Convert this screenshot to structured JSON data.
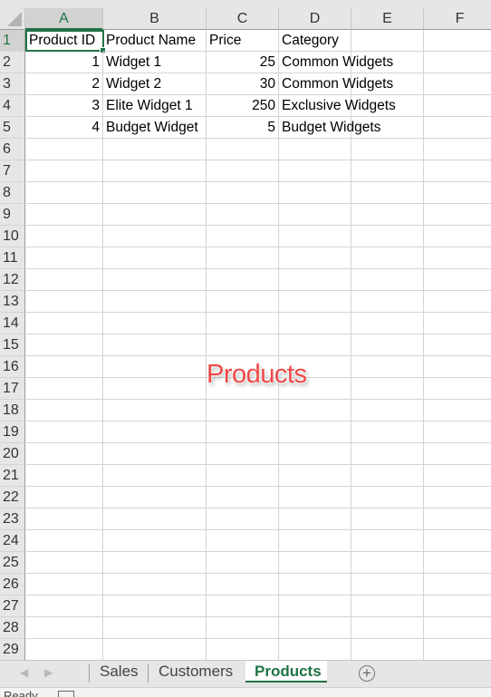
{
  "spreadsheet": {
    "columns": [
      "A",
      "B",
      "C",
      "D",
      "E",
      "F"
    ],
    "selected_column": "A",
    "selected_row": "1",
    "active_cell": "A1",
    "rows": [
      "1",
      "2",
      "3",
      "4",
      "5",
      "6",
      "7",
      "8",
      "9",
      "10",
      "11",
      "12",
      "13",
      "14",
      "15",
      "16",
      "17",
      "18",
      "19",
      "20",
      "21",
      "22",
      "23",
      "24",
      "25",
      "26",
      "27",
      "28",
      "29"
    ],
    "table": {
      "headers": [
        "Product ID",
        "Product Name",
        "Price",
        "Category"
      ],
      "records": [
        {
          "id": "1",
          "name": "Widget 1",
          "price": "25",
          "category": "Common Widgets"
        },
        {
          "id": "2",
          "name": "Widget 2",
          "price": "30",
          "category": "Common Widgets"
        },
        {
          "id": "3",
          "name": "Elite Widget 1",
          "price": "250",
          "category": "Exclusive Widgets"
        },
        {
          "id": "4",
          "name": "Budget Widget",
          "price": "5",
          "category": "Budget Widgets"
        }
      ]
    }
  },
  "overlay_label": "Products",
  "sheet_tabs": {
    "tabs": [
      {
        "label": "Sales",
        "active": false
      },
      {
        "label": "Customers",
        "active": false
      },
      {
        "label": "Products",
        "active": true
      }
    ],
    "add_sheet_icon": "plus-circle-icon",
    "nav_prev_icon": "triangle-left-icon",
    "nav_next_icon": "triangle-right-icon"
  },
  "status_bar": {
    "text": "Ready",
    "icon": "accessibility-icon"
  },
  "colors": {
    "accent": "#217346",
    "overlay_text": "#f04848"
  }
}
